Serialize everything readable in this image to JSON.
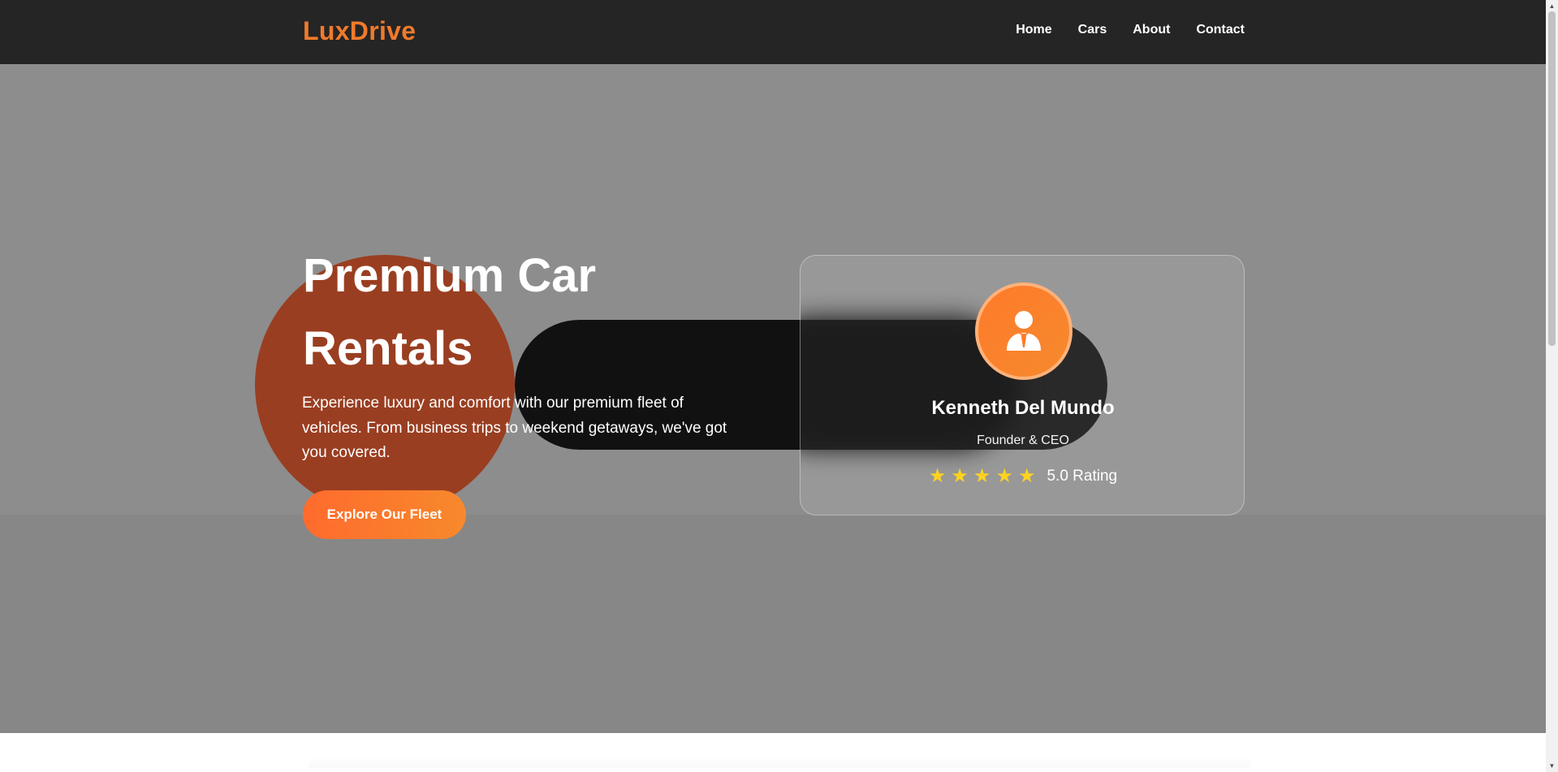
{
  "brand": {
    "logo_text": "LuxDrive"
  },
  "nav": {
    "items": [
      "Home",
      "Cars",
      "About",
      "Contact"
    ]
  },
  "hero": {
    "title_line1": "Premium Car",
    "title_line2": "Rentals",
    "description": "Experience luxury and comfort with our premium fleet of vehicles. From business trips to weekend getaways, we've got you covered.",
    "cta_label": "Explore Our Fleet"
  },
  "profile": {
    "name": "Kenneth Del Mundo",
    "role": "Founder & CEO",
    "stars": 5,
    "rating_text": "5.0 Rating",
    "avatar_icon": "user-tie-icon"
  },
  "colors": {
    "accent": "#f07a2c",
    "nav_bg": "#252525",
    "hero_bg": "#8d8d8d",
    "star": "#ffd21f"
  }
}
